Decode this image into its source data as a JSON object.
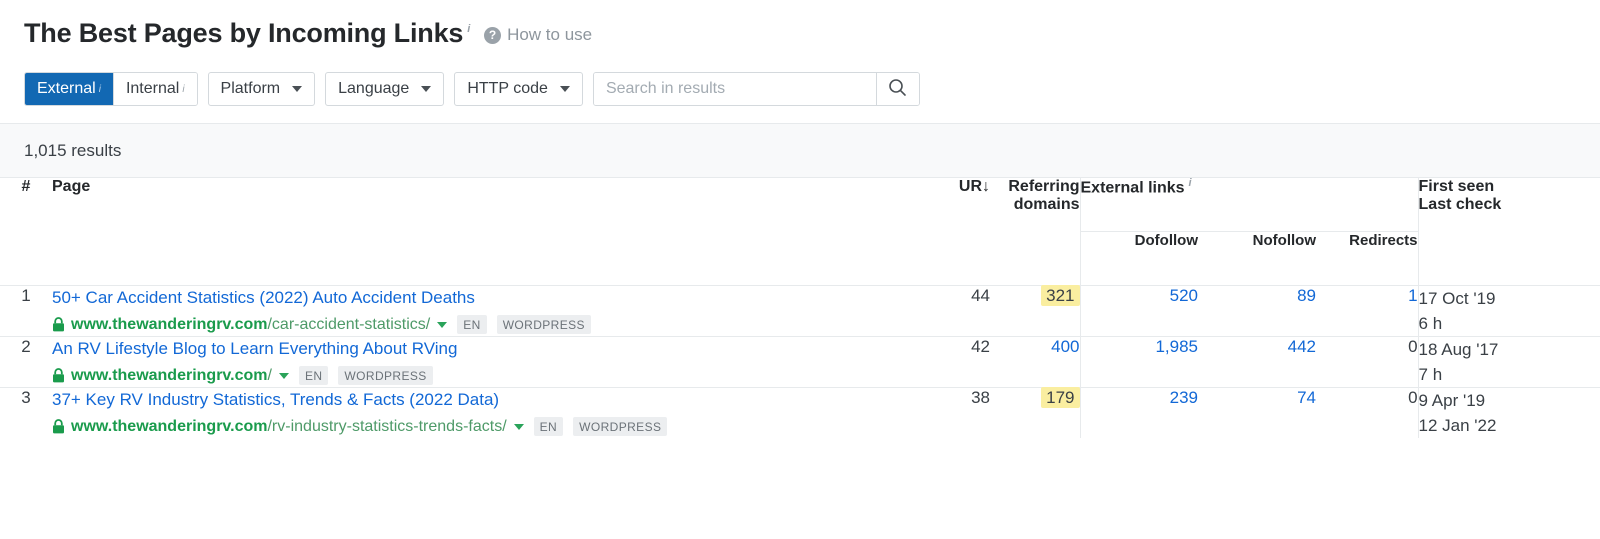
{
  "header": {
    "title": "The Best Pages by Incoming Links",
    "title_info_sup": "i",
    "how_to_use": "How to use",
    "help_icon_glyph": "?"
  },
  "filters": {
    "segmented": [
      {
        "label": "External",
        "sup": "i",
        "active": true
      },
      {
        "label": "Internal",
        "sup": "i",
        "active": false
      }
    ],
    "dropdowns": [
      {
        "label": "Platform"
      },
      {
        "label": "Language"
      },
      {
        "label": "HTTP code"
      }
    ],
    "search": {
      "placeholder": "Search in results",
      "value": "",
      "button_icon": "search-icon"
    }
  },
  "results": {
    "count_label": "1,015 results"
  },
  "table": {
    "headers": {
      "index": "#",
      "page": "Page",
      "ur": "UR",
      "ur_sort_arrow": "↓",
      "referring_domains_line1": "Referring",
      "referring_domains_line2": "domains",
      "external_links": "External links",
      "external_links_sup": "i",
      "dofollow": "Dofollow",
      "nofollow": "Nofollow",
      "redirects": "Redirects",
      "first_seen": "First seen",
      "last_check": "Last check"
    },
    "rows": [
      {
        "index": "1",
        "title": "50+ Car Accident Statistics (2022) Auto Accident Deaths",
        "url_domain": "www.thewanderingrv.com",
        "url_path": "/car-accident-statistics/",
        "badges": [
          "EN",
          "WORDPRESS"
        ],
        "ur": "44",
        "referring_domains": "321",
        "referring_domains_highlighted": true,
        "dofollow": "520",
        "nofollow": "89",
        "redirects": "1",
        "redirects_is_link": true,
        "first_seen": "17 Oct '19",
        "last_check": "6 h"
      },
      {
        "index": "2",
        "title": "An RV Lifestyle Blog to Learn Everything About RVing",
        "url_domain": "www.thewanderingrv.com",
        "url_path": "/",
        "badges": [
          "EN",
          "WORDPRESS"
        ],
        "ur": "42",
        "referring_domains": "400",
        "referring_domains_highlighted": false,
        "dofollow": "1,985",
        "nofollow": "442",
        "redirects": "0",
        "redirects_is_link": false,
        "first_seen": "18 Aug '17",
        "last_check": "7 h"
      },
      {
        "index": "3",
        "title": "37+ Key RV Industry Statistics, Trends & Facts (2022 Data)",
        "url_domain": "www.thewanderingrv.com",
        "url_path": "/rv-industry-statistics-trends-facts/",
        "badges": [
          "EN",
          "WORDPRESS"
        ],
        "ur": "38",
        "referring_domains": "179",
        "referring_domains_highlighted": true,
        "dofollow": "239",
        "nofollow": "74",
        "redirects": "0",
        "redirects_is_link": false,
        "first_seen": "9 Apr '19",
        "last_check": "12 Jan '22"
      }
    ]
  },
  "colors": {
    "accent_blue": "#1268b3",
    "link_blue": "#1268d6",
    "link_green": "#1a9b4c",
    "highlight_yellow": "#faeea0",
    "band_gray": "#f8f9fa",
    "border_gray": "#e7eaec"
  }
}
